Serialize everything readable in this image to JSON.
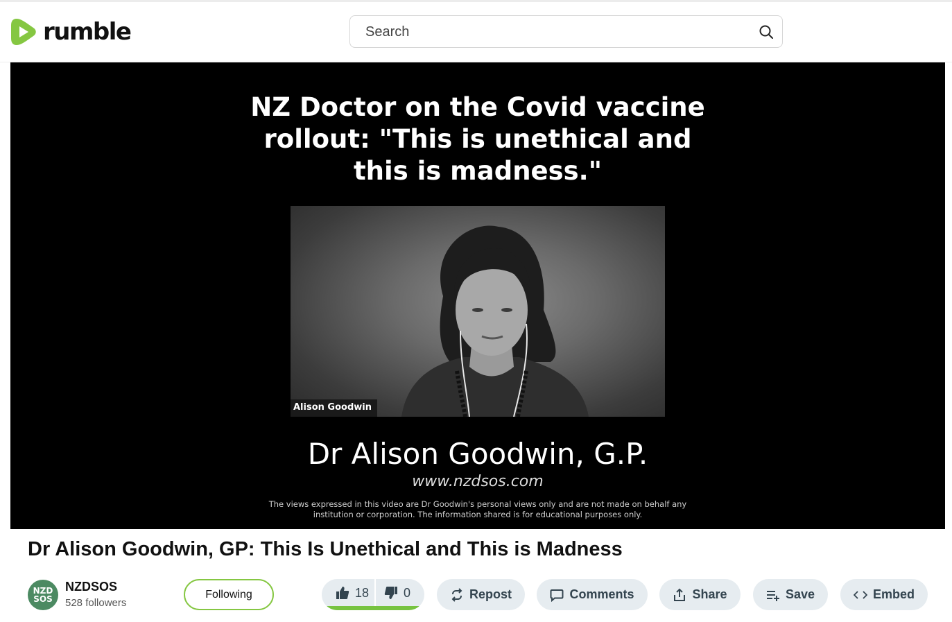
{
  "header": {
    "logo_text": "rumble",
    "search_placeholder": "Search"
  },
  "video": {
    "headline_lines": [
      "NZ Doctor on the Covid vaccine",
      "rollout: \"This is unethical and",
      "this is madness.\""
    ],
    "speaker_tag": "Alison Goodwin",
    "doctor_name": "Dr Alison Goodwin, G.P.",
    "website": "www.nzdsos.com",
    "disclaimer_lines": [
      "The views expressed in this video are Dr Goodwin's personal views only and are not made on behalf any",
      "institution or corporation. The information shared is for educational purposes only."
    ]
  },
  "title": "Dr Alison Goodwin, GP: This Is Unethical and This is Madness",
  "channel": {
    "avatar_line1": "NZD",
    "avatar_line2": "SOS",
    "name": "NZDSOS",
    "followers": "528 followers",
    "follow_label": "Following"
  },
  "actions": {
    "likes": "18",
    "dislikes": "0",
    "like_ratio": 1.0,
    "repost_label": "Repost",
    "comments_label": "Comments",
    "share_label": "Share",
    "save_label": "Save",
    "embed_label": "Embed"
  },
  "colors": {
    "brand_green": "#85c742",
    "pill_bg": "#e6ecf0",
    "pill_text": "#33444f"
  }
}
